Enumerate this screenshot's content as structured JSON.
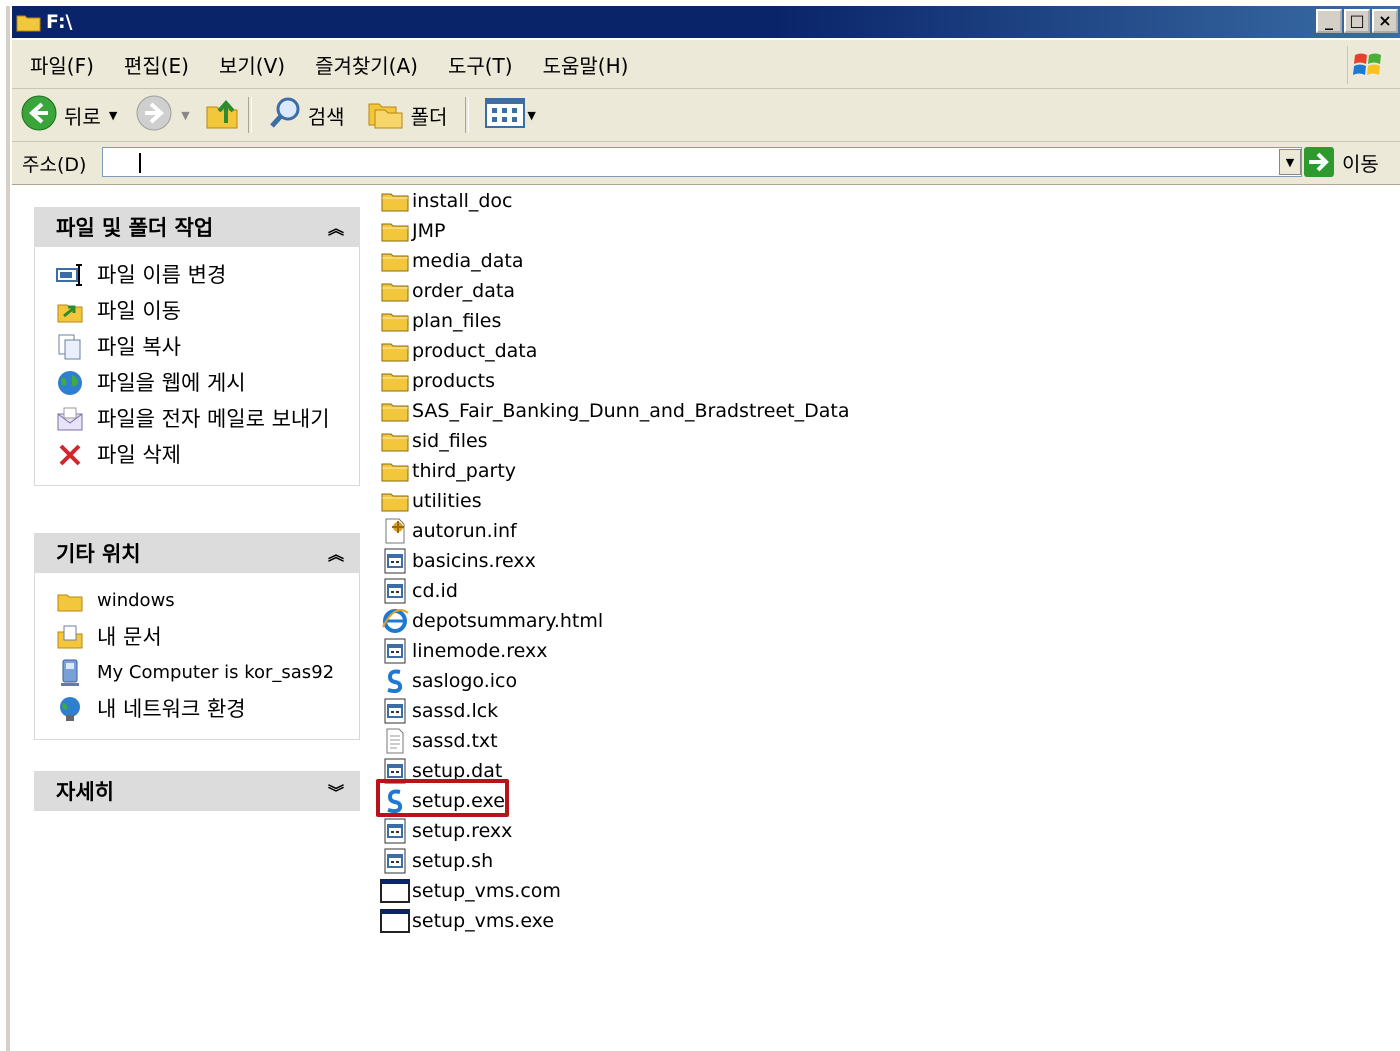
{
  "window": {
    "title": "F:\\"
  },
  "menu": [
    "파일(F)",
    "편집(E)",
    "보기(V)",
    "즐겨찾기(A)",
    "도구(T)",
    "도움말(H)"
  ],
  "toolbar": {
    "back": "뒤로",
    "search": "검색",
    "folders": "폴더"
  },
  "address": {
    "label": "주소(D)",
    "value": "",
    "go": "이동"
  },
  "tasks": {
    "title": "파일 및 폴더 작업",
    "items": [
      {
        "label": "파일 이름 변경",
        "icon": "rename-icon"
      },
      {
        "label": "파일 이동",
        "icon": "move-icon"
      },
      {
        "label": "파일 복사",
        "icon": "copy-icon"
      },
      {
        "label": "파일을 웹에 게시",
        "icon": "globe-icon"
      },
      {
        "label": "파일을 전자 메일로 보내기",
        "icon": "email-icon"
      },
      {
        "label": "파일 삭제",
        "icon": "delete-icon"
      }
    ]
  },
  "places": {
    "title": "기타 위치",
    "items": [
      {
        "label": "windows",
        "icon": "folder-icon"
      },
      {
        "label": "내 문서",
        "icon": "documents-icon"
      },
      {
        "label": "My Computer is kor_sas92",
        "icon": "computer-icon"
      },
      {
        "label": "내 네트워크 환경",
        "icon": "network-icon"
      }
    ]
  },
  "details": {
    "title": "자세히"
  },
  "files": [
    {
      "name": "install_doc",
      "type": "folder"
    },
    {
      "name": "JMP",
      "type": "folder"
    },
    {
      "name": "media_data",
      "type": "folder"
    },
    {
      "name": "order_data",
      "type": "folder"
    },
    {
      "name": "plan_files",
      "type": "folder"
    },
    {
      "name": "product_data",
      "type": "folder"
    },
    {
      "name": "products",
      "type": "folder"
    },
    {
      "name": "SAS_Fair_Banking_Dunn_and_Bradstreet_Data",
      "type": "folder"
    },
    {
      "name": "sid_files",
      "type": "folder"
    },
    {
      "name": "third_party",
      "type": "folder"
    },
    {
      "name": "utilities",
      "type": "folder"
    },
    {
      "name": "autorun.inf",
      "type": "inf"
    },
    {
      "name": "basicins.rexx",
      "type": "script"
    },
    {
      "name": "cd.id",
      "type": "script"
    },
    {
      "name": "depotsummary.html",
      "type": "html"
    },
    {
      "name": "linemode.rexx",
      "type": "script"
    },
    {
      "name": "saslogo.ico",
      "type": "sas"
    },
    {
      "name": "sassd.lck",
      "type": "script"
    },
    {
      "name": "sassd.txt",
      "type": "text"
    },
    {
      "name": "setup.dat",
      "type": "script"
    },
    {
      "name": "setup.exe",
      "type": "sas"
    },
    {
      "name": "setup.rexx",
      "type": "script"
    },
    {
      "name": "setup.sh",
      "type": "script"
    },
    {
      "name": "setup_vms.com",
      "type": "window"
    },
    {
      "name": "setup_vms.exe",
      "type": "window"
    }
  ],
  "selected": "setup.exe",
  "colors": {
    "titlebar": "#0a246a",
    "highlight": "#b8121b",
    "chrome": "#ece9d8"
  }
}
